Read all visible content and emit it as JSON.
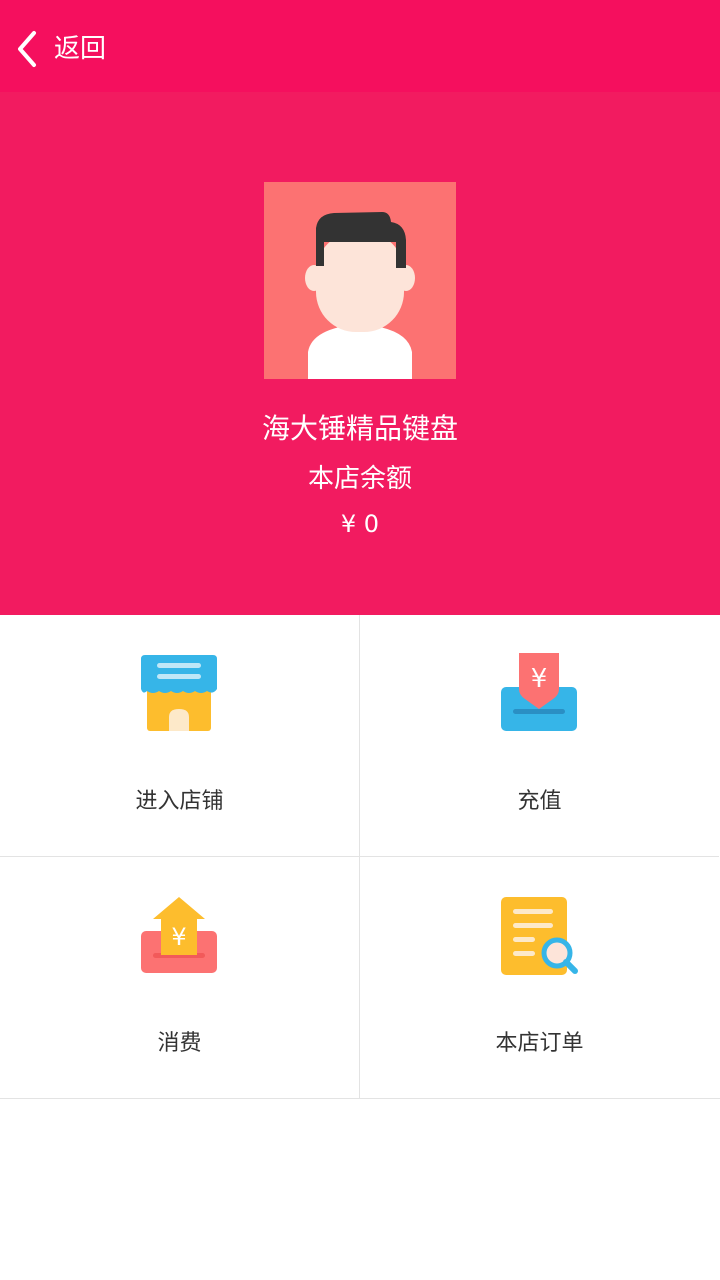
{
  "header": {
    "back_label": "返回"
  },
  "profile": {
    "shop_name": "海大锤精品键盘",
    "balance_label": "本店余额",
    "balance_value": "¥ 0"
  },
  "menu": {
    "items": [
      {
        "label": "进入店铺",
        "icon": "store-icon"
      },
      {
        "label": "充值",
        "icon": "recharge-icon"
      },
      {
        "label": "消费",
        "icon": "consume-icon"
      },
      {
        "label": "本店订单",
        "icon": "order-search-icon"
      }
    ]
  },
  "colors": {
    "header_bg": "#f50f5e",
    "hero_bg": "#f21b60",
    "avatar_bg": "#fc7272"
  }
}
